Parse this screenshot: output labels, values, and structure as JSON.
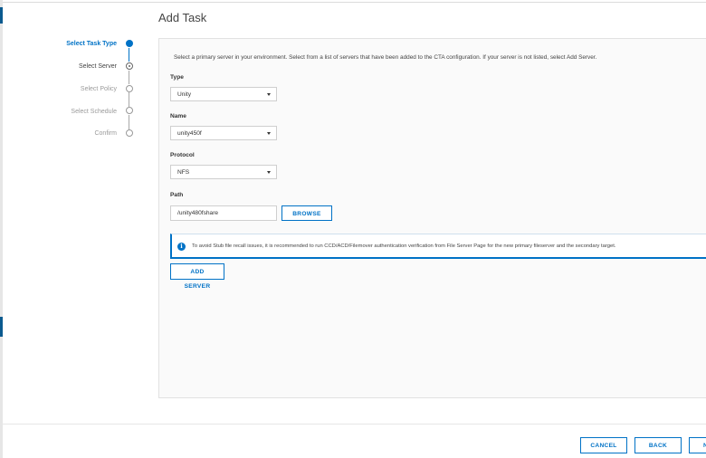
{
  "dialog": {
    "title": "Add Task"
  },
  "stepper": {
    "steps": [
      {
        "label": "Select Task Type",
        "state": "active"
      },
      {
        "label": "Select Server",
        "state": "current"
      },
      {
        "label": "Select Policy",
        "state": "future"
      },
      {
        "label": "Select Schedule",
        "state": "future"
      },
      {
        "label": "Confirm",
        "state": "future"
      }
    ]
  },
  "form": {
    "description": "Select a primary server in your environment. Select from a list of servers that have been added to the CTA configuration. If your server is not listed, select Add Server.",
    "type": {
      "label": "Type",
      "value": "Unity"
    },
    "name": {
      "label": "Name",
      "value": "unity450f"
    },
    "protocol": {
      "label": "Protocol",
      "value": "NFS"
    },
    "path": {
      "label": "Path",
      "value": "/unity480fshare",
      "browse_label": "BROWSE"
    },
    "alert": {
      "icon": "info-icon",
      "text": "To avoid Stub file recall issues, it is recommended to run CCD/ACD/Filemover authentication verification from File Server Page for the new primary fileserver and the secondary target."
    },
    "add_server_label": "ADD SERVER"
  },
  "footer": {
    "cancel_label": "CANCEL",
    "back_label": "BACK",
    "next_label": "N"
  },
  "colors": {
    "accent": "#0072c6",
    "panel_bg": "#fafafa"
  }
}
